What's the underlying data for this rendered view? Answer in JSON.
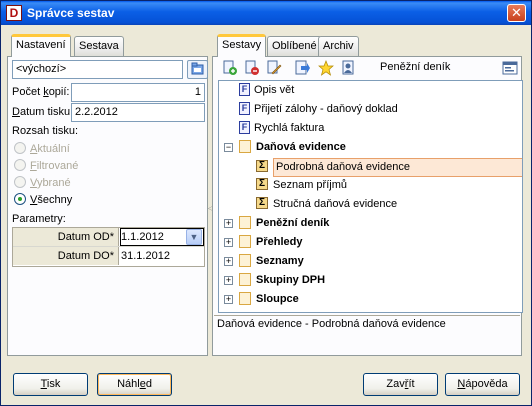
{
  "window": {
    "title": "Správce sestav",
    "close_glyph": "✕"
  },
  "left_tabs": [
    {
      "label": "Nastavení",
      "active": true
    },
    {
      "label": "Sestava",
      "active": false
    }
  ],
  "settings": {
    "preset_value": "<výchozí>",
    "copies_label_pre": "Počet ",
    "copies_label_u": "k",
    "copies_label_post": "opií:",
    "copies_value": "1",
    "print_date_label_u": "D",
    "print_date_label_post": "atum tisku:",
    "print_date_value": "2.2.2012",
    "range_label": "Rozsah tisku:",
    "range_options": [
      {
        "u": "A",
        "rest": "ktuální",
        "enabled": false,
        "selected": false
      },
      {
        "u": "F",
        "rest": "iltrované",
        "enabled": false,
        "selected": false
      },
      {
        "u": "V",
        "rest": "ybrané",
        "enabled": false,
        "selected": false
      },
      {
        "u": "V",
        "rest": "šechny",
        "enabled": true,
        "selected": true
      }
    ],
    "params_label": "Parametry:",
    "params": [
      {
        "name": "Datum OD*",
        "value": "1.1.2012"
      },
      {
        "name": "Datum DO*",
        "value": "31.1.2012"
      }
    ]
  },
  "right_tabs": [
    {
      "label": "Sestavy",
      "active": true
    },
    {
      "label": "Oblíbené",
      "active": false
    },
    {
      "label": "Archiv",
      "active": false
    }
  ],
  "toolbar": {
    "icons": [
      "add-icon",
      "remove-icon",
      "edit-icon",
      "import-icon",
      "favorite-star-icon",
      "user-icon"
    ],
    "current_report": "Peněžní deník",
    "settings_icon": "window-settings-icon"
  },
  "tree": [
    {
      "type": "form",
      "label": "Opis vět",
      "level": 0,
      "bold": false
    },
    {
      "type": "form",
      "label": "Přijetí zálohy - daňový doklad",
      "level": 0,
      "bold": false
    },
    {
      "type": "form",
      "label": "Rychlá faktura",
      "level": 0,
      "bold": false
    },
    {
      "type": "folder",
      "label": "Daňová evidence",
      "level": 0,
      "bold": true,
      "expanded": true
    },
    {
      "type": "sum",
      "label": "Podrobná daňová evidence",
      "level": 1,
      "bold": false,
      "selected": true
    },
    {
      "type": "sum",
      "label": "Seznam příjmů",
      "level": 1,
      "bold": false
    },
    {
      "type": "sum",
      "label": "Stručná daňová evidence",
      "level": 1,
      "bold": false
    },
    {
      "type": "folder",
      "label": "Peněžní deník",
      "level": 0,
      "bold": true,
      "expanded": false
    },
    {
      "type": "folder",
      "label": "Přehledy",
      "level": 0,
      "bold": true,
      "expanded": false
    },
    {
      "type": "folder",
      "label": "Seznamy",
      "level": 0,
      "bold": true,
      "expanded": false
    },
    {
      "type": "folder",
      "label": "Skupiny DPH",
      "level": 0,
      "bold": true,
      "expanded": false
    },
    {
      "type": "folder",
      "label": "Sloupce",
      "level": 0,
      "bold": true,
      "expanded": false
    }
  ],
  "status_text": "Daňová evidence - Podrobná daňová evidence",
  "buttons": {
    "print_u": "T",
    "print_rest": "isk",
    "preview_pre": "Náhl",
    "preview_u": "e",
    "preview_post": "d",
    "close_pre": "Zav",
    "close_u": "ř",
    "close_post": "ít",
    "help_pre": "",
    "help_u": "N",
    "help_post": "ápověda"
  },
  "colors": {
    "accent_tab": "#ffc83c",
    "title_bar": "#0551d6",
    "selection": "#fde8d6"
  }
}
